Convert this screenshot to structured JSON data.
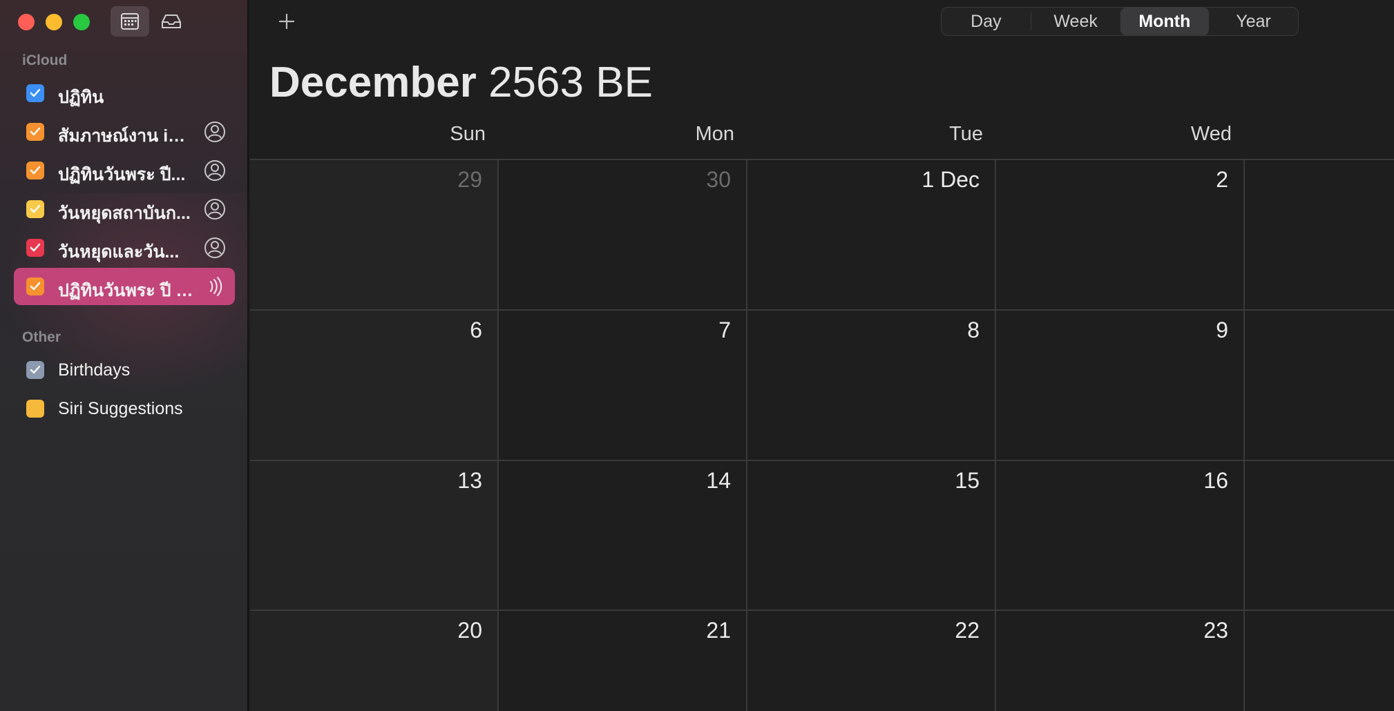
{
  "toolbar": {
    "calendar_view_icon": "calendar-icon",
    "inbox_icon": "inbox-icon",
    "add_icon": "plus-icon"
  },
  "sidebar": {
    "sections": [
      {
        "label": "iCloud",
        "items": [
          {
            "name": "ปฏิทิน",
            "color": "#3b8ff5",
            "shared": false,
            "subscribed": false,
            "selected": false
          },
          {
            "name": "สัมภาษณ์งาน iM...",
            "color": "#f5922f",
            "shared": true,
            "subscribed": false,
            "selected": false
          },
          {
            "name": "ปฏิทินวันพระ ปี...",
            "color": "#f5922f",
            "shared": true,
            "subscribed": false,
            "selected": false
          },
          {
            "name": "วันหยุดสถาบันก...",
            "color": "#f7c948",
            "shared": true,
            "subscribed": false,
            "selected": false
          },
          {
            "name": "วันหยุดและวัน...",
            "color": "#e8384f",
            "shared": true,
            "subscribed": false,
            "selected": false
          },
          {
            "name": "ปฏิทินวันพระ ปี 2...",
            "color": "#f5922f",
            "shared": false,
            "subscribed": true,
            "selected": true
          }
        ]
      },
      {
        "label": "Other",
        "items": [
          {
            "name": "Birthdays",
            "color": "#8c9ab0",
            "checked": true
          },
          {
            "name": "Siri Suggestions",
            "color": "#f7b93b",
            "checked": false
          }
        ]
      }
    ]
  },
  "view_switcher": {
    "options": [
      "Day",
      "Week",
      "Month",
      "Year"
    ],
    "active": "Month"
  },
  "header": {
    "month": "December",
    "year": "2563 BE"
  },
  "weekdays": [
    "Sun",
    "Mon",
    "Tue",
    "Wed"
  ],
  "weeks": [
    [
      {
        "label": "29",
        "dim": true
      },
      {
        "label": "30",
        "dim": true
      },
      {
        "label": "1 Dec",
        "dim": false
      },
      {
        "label": "2",
        "dim": false
      }
    ],
    [
      {
        "label": "6",
        "dim": false
      },
      {
        "label": "7",
        "dim": false
      },
      {
        "label": "8",
        "dim": false
      },
      {
        "label": "9",
        "dim": false
      }
    ],
    [
      {
        "label": "13",
        "dim": false
      },
      {
        "label": "14",
        "dim": false
      },
      {
        "label": "15",
        "dim": false
      },
      {
        "label": "16",
        "dim": false
      }
    ],
    [
      {
        "label": "20",
        "dim": false
      },
      {
        "label": "21",
        "dim": false
      },
      {
        "label": "22",
        "dim": false
      },
      {
        "label": "23",
        "dim": false
      }
    ]
  ]
}
